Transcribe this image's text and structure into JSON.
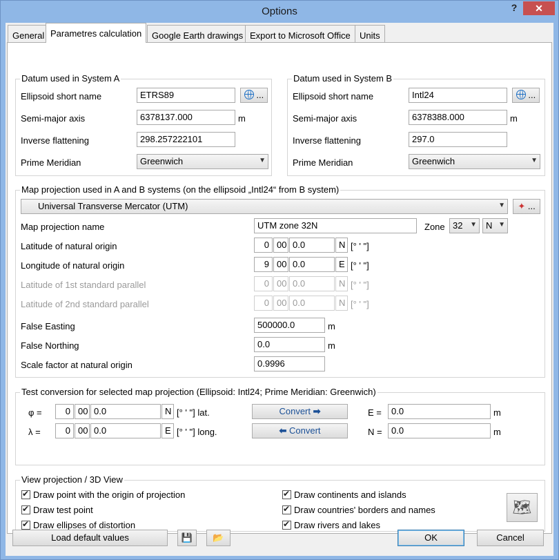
{
  "window": {
    "title": "Options",
    "help": "?",
    "close": "✕"
  },
  "tabs": [
    "General",
    "Parametres calculation",
    "Google Earth drawings",
    "Export to Microsoft Office",
    "Units"
  ],
  "systemA": {
    "title": "Datum used in System A",
    "ellipsoid_label": "Ellipsoid short name",
    "ellipsoid": "ETRS89",
    "semimajor_label": "Semi-major axis",
    "semimajor": "6378137.000",
    "semimajor_unit": "m",
    "invflat_label": "Inverse flattening",
    "invflat": "298.257222101",
    "meridian_label": "Prime Meridian",
    "meridian": "Greenwich",
    "browse": "..."
  },
  "systemB": {
    "title": "Datum used in System B",
    "ellipsoid_label": "Ellipsoid short name",
    "ellipsoid": "Intl24",
    "semimajor_label": "Semi-major axis",
    "semimajor": "6378388.000",
    "semimajor_unit": "m",
    "invflat_label": "Inverse flattening",
    "invflat": "297.0",
    "meridian_label": "Prime Meridian",
    "meridian": "Greenwich",
    "browse": "..."
  },
  "projection": {
    "title": "Map projection used in A and B systems (on the ellipsoid „Intl24“ from B system)",
    "selected": "Universal Transverse Mercator (UTM)",
    "browse": "...",
    "name_label": "Map projection name",
    "name": "UTM zone 32N",
    "zone_label": "Zone",
    "zone": "32",
    "hemisphere": "N",
    "lat_origin_label": "Latitude of natural origin",
    "lat_d": "0",
    "lat_m": "00",
    "lat_s": "0.0",
    "lat_h": "N",
    "lon_origin_label": "Longitude of natural origin",
    "lon_d": "9",
    "lon_m": "00",
    "lon_s": "0.0",
    "lon_h": "E",
    "std1_label": "Latitude of 1st standard parallel",
    "std1_d": "0",
    "std1_m": "00",
    "std1_s": "0.0",
    "std1_h": "N",
    "std2_label": "Latitude of 2nd standard parallel",
    "std2_d": "0",
    "std2_m": "00",
    "std2_s": "0.0",
    "std2_h": "N",
    "dms_unit": "[° ' \"]",
    "false_easting_label": "False Easting",
    "false_easting": "500000.0",
    "false_northing_label": "False Northing",
    "false_northing": "0.0",
    "scale_label": "Scale factor at natural origin",
    "scale": "0.9996",
    "m": "m"
  },
  "test": {
    "title": "Test conversion for selected map projection (Ellipsoid: Intl24; Prime Meridian: Greenwich)",
    "phi_label": "φ =",
    "phi_d": "0",
    "phi_m": "00",
    "phi_s": "0.0",
    "phi_h": "N",
    "phi_unit": "[° ' \"] lat.",
    "lam_label": "λ =",
    "lam_d": "0",
    "lam_m": "00",
    "lam_s": "0.0",
    "lam_h": "E",
    "lam_unit": "[° ' \"] long.",
    "convert_fwd": "Convert",
    "convert_back": "Convert",
    "e_label": "E =",
    "e_value": "0.0",
    "n_label": "N =",
    "n_value": "0.0",
    "m": "m"
  },
  "view": {
    "title": "View projection / 3D View",
    "left": [
      "Draw point with the origin of projection",
      "Draw test point",
      "Draw ellipses of distortion"
    ],
    "right": [
      "Draw continents and islands",
      "Draw countries' borders and names",
      "Draw rivers and lakes"
    ]
  },
  "footer": {
    "load_defaults": "Load default values",
    "ok": "OK",
    "cancel": "Cancel"
  },
  "colors": {
    "accent": "#1d6fc4",
    "title_bar": "#8fb7e6",
    "close": "#c75050"
  }
}
